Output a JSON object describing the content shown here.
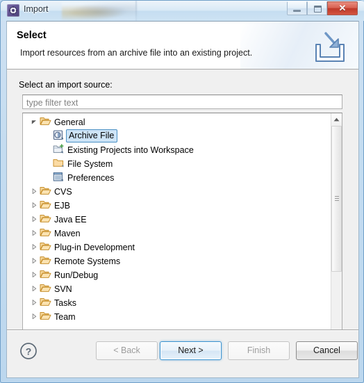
{
  "window": {
    "title": "Import",
    "app_icon": "import-wizard-icon",
    "controls": {
      "minimize": "minimize-button",
      "maximize": "maximize-button",
      "close_glyph": "✕"
    }
  },
  "banner": {
    "title": "Select",
    "description": "Import resources from an archive file into an existing project.",
    "icon": "import-arrow-into-tray-icon"
  },
  "body": {
    "source_label": "Select an import source:",
    "filter": {
      "value": "",
      "placeholder": "type filter text"
    },
    "tree": [
      {
        "label": "General",
        "level": 0,
        "icon": "folder-open-icon",
        "expanded": true,
        "has_children": true,
        "selected": false
      },
      {
        "label": "Archive File",
        "level": 1,
        "icon": "archive-file-icon",
        "expanded": false,
        "has_children": false,
        "selected": true
      },
      {
        "label": "Existing Projects into Workspace",
        "level": 1,
        "icon": "existing-projects-icon",
        "expanded": false,
        "has_children": false,
        "selected": false
      },
      {
        "label": "File System",
        "level": 1,
        "icon": "folder-closed-icon",
        "expanded": false,
        "has_children": false,
        "selected": false
      },
      {
        "label": "Preferences",
        "level": 1,
        "icon": "preferences-icon",
        "expanded": false,
        "has_children": false,
        "selected": false
      },
      {
        "label": "CVS",
        "level": 0,
        "icon": "folder-open-icon",
        "expanded": false,
        "has_children": true,
        "selected": false
      },
      {
        "label": "EJB",
        "level": 0,
        "icon": "folder-open-icon",
        "expanded": false,
        "has_children": true,
        "selected": false
      },
      {
        "label": "Java EE",
        "level": 0,
        "icon": "folder-open-icon",
        "expanded": false,
        "has_children": true,
        "selected": false
      },
      {
        "label": "Maven",
        "level": 0,
        "icon": "folder-open-icon",
        "expanded": false,
        "has_children": true,
        "selected": false
      },
      {
        "label": "Plug-in Development",
        "level": 0,
        "icon": "folder-open-icon",
        "expanded": false,
        "has_children": true,
        "selected": false
      },
      {
        "label": "Remote Systems",
        "level": 0,
        "icon": "folder-open-icon",
        "expanded": false,
        "has_children": true,
        "selected": false
      },
      {
        "label": "Run/Debug",
        "level": 0,
        "icon": "folder-open-icon",
        "expanded": false,
        "has_children": true,
        "selected": false
      },
      {
        "label": "SVN",
        "level": 0,
        "icon": "folder-open-icon",
        "expanded": false,
        "has_children": true,
        "selected": false
      },
      {
        "label": "Tasks",
        "level": 0,
        "icon": "folder-open-icon",
        "expanded": false,
        "has_children": true,
        "selected": false
      },
      {
        "label": "Team",
        "level": 0,
        "icon": "folder-open-icon",
        "expanded": false,
        "has_children": true,
        "selected": false
      }
    ]
  },
  "footer": {
    "help": "?",
    "back": {
      "label": "< Back",
      "enabled": false
    },
    "next": {
      "label": "Next >",
      "enabled": true,
      "default": true
    },
    "finish": {
      "label": "Finish",
      "enabled": false
    },
    "cancel": {
      "label": "Cancel",
      "enabled": true
    }
  },
  "colors": {
    "title_bar": "#c4dcf0",
    "dialog_bg": "#f0f0f0",
    "selection_fill": "#cde4f7",
    "selection_border": "#4a90c4",
    "default_button_border": "#3c93d0",
    "close_button": "#bf3a2a",
    "folder_icon": "#e8a33d"
  }
}
